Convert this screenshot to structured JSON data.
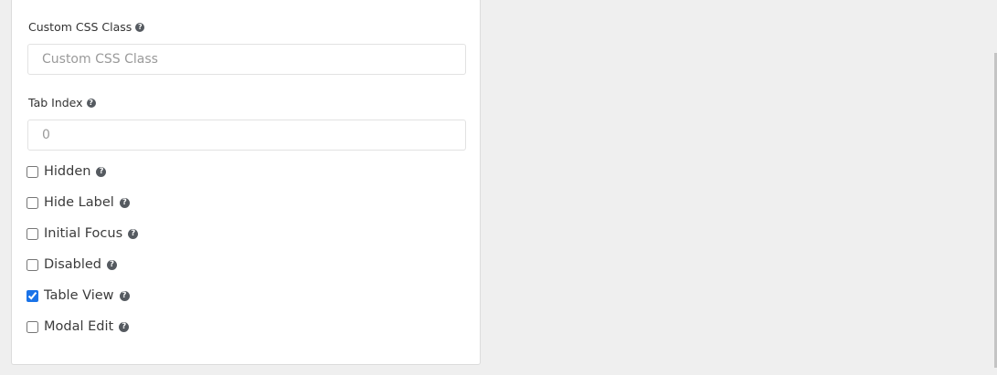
{
  "form": {
    "custom_css": {
      "label": "Custom CSS Class",
      "placeholder": "Custom CSS Class",
      "help_icon": "question-circle-icon"
    },
    "tab_index": {
      "label": "Tab Index",
      "placeholder": "0",
      "help_icon": "question-circle-icon"
    },
    "checkboxes": [
      {
        "label": "Hidden",
        "checked": false
      },
      {
        "label": "Hide Label",
        "checked": false
      },
      {
        "label": "Initial Focus",
        "checked": false
      },
      {
        "label": "Disabled",
        "checked": false
      },
      {
        "label": "Table View",
        "checked": true
      },
      {
        "label": "Modal Edit",
        "checked": false
      }
    ],
    "help_glyph": "?"
  },
  "colors": {
    "accent": "#1a73e8",
    "background": "#efefef",
    "panel": "#ffffff"
  }
}
